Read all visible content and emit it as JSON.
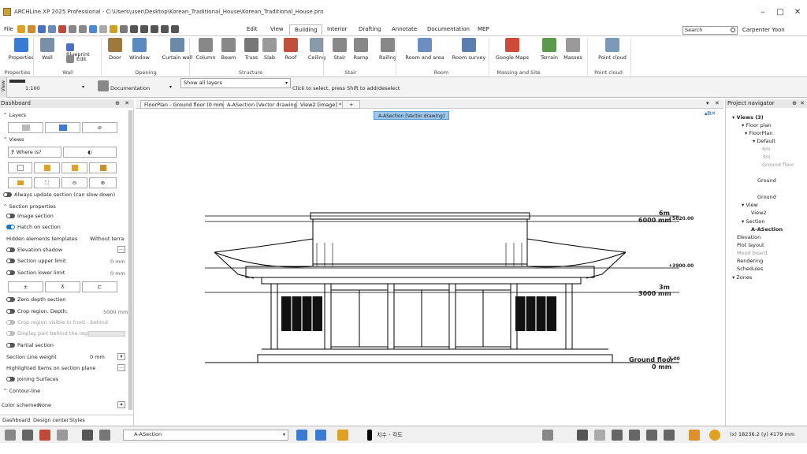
{
  "window": {
    "title": "ARCHLine.XP 2025 Professional - C:\\Users\\user\\Desktop\\Korean_Traditional_House\\Korean_Traditional_House.pro",
    "minimize": "–",
    "maximize": "□",
    "close": "✕"
  },
  "menu": {
    "items": [
      "File",
      "Edit",
      "View",
      "Building",
      "Interior",
      "Drafting",
      "Annotate",
      "Documentation",
      "MEP"
    ],
    "active": "Building"
  },
  "search": {
    "placeholder": "Search"
  },
  "user": {
    "name": "Carpenter Yoon"
  },
  "ribbon": {
    "buttons": [
      {
        "label": "Properties",
        "icon": "properties-icon",
        "color": "#3a7bd5"
      },
      {
        "label": "Wall",
        "icon": "wall-icon",
        "color": "#7a90a8"
      },
      {
        "label": "Blueprint",
        "icon": "blueprint-icon",
        "color": "#4a70c0"
      },
      {
        "label": "Edit",
        "icon": "edit-icon",
        "color": "#888888"
      },
      {
        "label": "Door",
        "icon": "door-icon",
        "color": "#a0783c"
      },
      {
        "label": "Window",
        "icon": "window-icon",
        "color": "#5a8ac0"
      },
      {
        "label": "Curtain wall",
        "icon": "curtain-wall-icon",
        "color": "#6a8aa8"
      },
      {
        "label": "Column",
        "icon": "column-icon",
        "color": "#888888"
      },
      {
        "label": "Beam",
        "icon": "beam-icon",
        "color": "#888888"
      },
      {
        "label": "Truss",
        "icon": "truss-icon",
        "color": "#777777"
      },
      {
        "label": "Slab",
        "icon": "slab-icon",
        "color": "#999999"
      },
      {
        "label": "Roof",
        "icon": "roof-icon",
        "color": "#c0503c"
      },
      {
        "label": "Ceiling",
        "icon": "ceiling-icon",
        "color": "#8899aa"
      },
      {
        "label": "Stair",
        "icon": "stair-icon",
        "color": "#888888"
      },
      {
        "label": "Ramp",
        "icon": "ramp-icon",
        "color": "#888888"
      },
      {
        "label": "Railing",
        "icon": "railing-icon",
        "color": "#888888"
      },
      {
        "label": "Room and area",
        "icon": "room-icon",
        "color": "#6a8fc0"
      },
      {
        "label": "Room survey",
        "icon": "room-survey-icon",
        "color": "#5a7fb0"
      },
      {
        "label": "Google Maps",
        "icon": "google-maps-icon",
        "color": "#d04a3a"
      },
      {
        "label": "Terrain",
        "icon": "terrain-icon",
        "color": "#5a9a4a"
      },
      {
        "label": "Masses",
        "icon": "masses-icon",
        "color": "#9a9a9a"
      },
      {
        "label": "Point cloud",
        "icon": "point-cloud-icon",
        "color": "#7a9ab8"
      }
    ],
    "groups": [
      "Properties",
      "Wall",
      "Opening",
      "Structure",
      "Stair",
      "Room",
      "Massing and Site",
      "Point cloud"
    ]
  },
  "optionbar": {
    "view_tab": "View",
    "scale": "1:100",
    "style": "Documentation",
    "layers": "Show all layers",
    "hint": "Click to select, press Shift to add/deselect"
  },
  "dashboard": {
    "title": "Dashboard",
    "layers": "Layers",
    "views": "Views",
    "where_is": "Where is?",
    "always_update": "Always update section (can slow down)",
    "section_properties": "Section properties",
    "image_section": "Image section",
    "hatch_on_section": "Hatch on section",
    "hidden_templates": "Hidden elements templates",
    "hidden_templates_value": "Without terra",
    "elevation_shadow": "Elevation shadow",
    "upper_limit": "Section upper limit",
    "upper_limit_value": "0 mm",
    "lower_limit": "Section lower limit",
    "lower_limit_value": "0 mm",
    "zero_depth": "Zero depth section",
    "crop_region": "Crop region. Depth:",
    "crop_region_value": "5000 mm",
    "crop_visible": "Crop region visible in front - behind",
    "display_part": "Display part behind the region (-",
    "partial": "Partial section",
    "line_weight": "Section Line weight",
    "line_weight_value": "0 mm",
    "highlighted": "Highlighted items on section plane",
    "joining": "Joining Surfaces",
    "contour": "Contour-line",
    "color_schemes": "Color schemes",
    "color_schemes_value": "None",
    "tabs": [
      "Dashboard",
      "Design center",
      "Styles"
    ]
  },
  "doctabs": [
    "FloorPlan - Ground floor (0 mm)",
    "A-ASection [Vector drawing]",
    "View2 [image] *",
    "+"
  ],
  "canvas": {
    "badge": "A-ASection [Vector drawing]",
    "labels": {
      "top1": "6m",
      "top2": "6000 mm",
      "top3": "+5820.00",
      "mid0": "+3900.00",
      "mid1": "3m",
      "mid2": "3000 mm",
      "gf1": "Ground floor",
      "gf2": "0 mm",
      "gf3": "7.00"
    }
  },
  "navigator": {
    "title": "Project navigator",
    "items": [
      "Views (3)",
      "Floor plan",
      "FloorPlan",
      "Default",
      "6m",
      "3m",
      "Ground floor",
      "Ground",
      "Ground",
      "View",
      "View2",
      "Section",
      "A-ASection",
      "Elevation",
      "Plot layout",
      "Mood board",
      "Rendering",
      "Schedules",
      "Zones"
    ]
  },
  "status": {
    "view": "A-ASection",
    "text": "치수 - 각도",
    "coords": "(x) 18236.2  (y) 4179 mm"
  }
}
